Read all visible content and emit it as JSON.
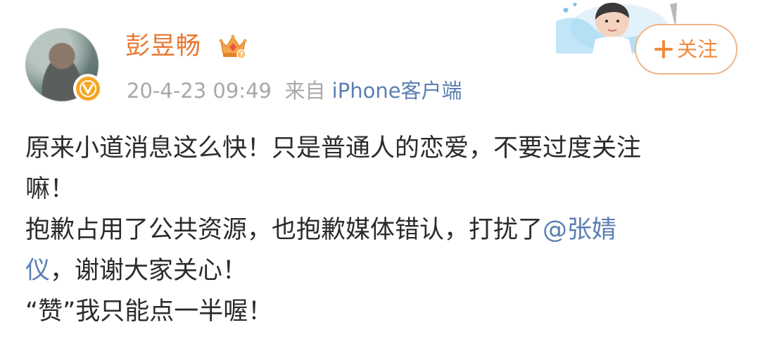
{
  "header": {
    "username": "彭昱畅",
    "timestamp": "20-4-23 09:49",
    "source_prefix": "来自",
    "source": "iPhone客户端",
    "avatar_icon": "user-avatar",
    "verified_icon": "verified-v-icon",
    "crown_icon": "vip-crown-icon"
  },
  "follow": {
    "label": "关注",
    "icon": "plus-icon"
  },
  "post": {
    "line1": "原来小道消息这么快！只是普通人的恋爱，不要过度关注",
    "line2": "嘛！",
    "line3_before": "抱歉占用了公共资源，也抱歉媒体错认，打扰了",
    "mention_part1": "@张婧",
    "mention_part2": "仪",
    "line4_after": "，谢谢大家关心！",
    "line5": "“赞”我只能点一半喔！"
  },
  "colors": {
    "username": "#e8772e",
    "link": "#5b7fb3",
    "meta": "#a8a8a8",
    "text": "#2b2b2b",
    "follow_border": "#f0b48a",
    "follow_text": "#f08a3c",
    "badge": "#f5a623"
  }
}
